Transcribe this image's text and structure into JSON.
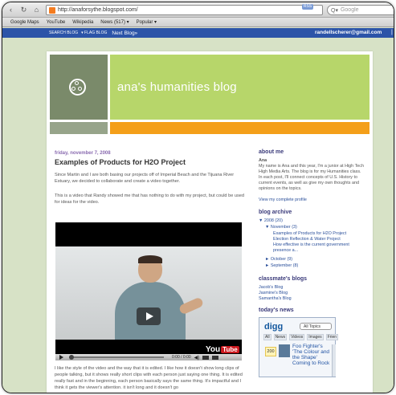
{
  "browser": {
    "url": "http://anaforsythe.blogspot.com/",
    "rss_label": "RSS",
    "search_placeholder": "Google",
    "search_icon": "Q▾",
    "back_icon": "‹",
    "refresh_icon": "↻",
    "home_icon": "⌂",
    "bookmarks": [
      "Google Maps",
      "YouTube",
      "Wikipedia",
      "News (517) ▾",
      "Popular ▾"
    ]
  },
  "navbar": {
    "search_blog": "SEARCH BLOG",
    "flag_blog": "▾ FLAG BLOG",
    "next_blog": "Next Blog»",
    "email": "randellscherer@gmail.com",
    "sep": "|"
  },
  "blog": {
    "title": "ana's humanities blog",
    "colors": {
      "banner": "#b7d66a",
      "orange": "#f49f1a",
      "logo": "#7a8a6a",
      "page_bg": "#d7e2c6"
    }
  },
  "post": {
    "date": "friday, november 7, 2008",
    "title": "Examples of Products for H2O Project",
    "p1": "Since Martin and I are both basing our projects off of Imperial Beach and the Tijuana River Estuary, we decided to collaborate and create a video together.",
    "p2": "This is a video that Randy showed me that has nothing to do with my project, but could be used for ideas for the video.",
    "video": {
      "time": "0:00 / 0:00",
      "logo_you": "You",
      "logo_tube": "Tube",
      "volume_icon": "◀)"
    },
    "p3": "I like the style of the video and the way that it is edited. I like how it doesn't show long clips of people talking, but it shows really short clips with each person just saying one thing. It is edited really fast and in the beginning, each person basically says the same thing. It's impactful and I think it gets the viewer's attention. it isn't long and it doesn't go"
  },
  "sidebar": {
    "about_heading": "about me",
    "about_name": "Ana",
    "about_text": "My name is Ana and this year, I'm a junior at High Tech High Media Arts. The blog is for my Humanities class. In each post, I'll connect concepts of U.S. History to current events, as well as give my own thoughts and opinions on the topics.",
    "about_link": "View my complete profile",
    "archive_heading": "blog archive",
    "archive": {
      "year": "▼ 2008 (20)",
      "month": "▼ November (3)",
      "posts": [
        "Examples of Products for H2O Project",
        "Election Reflection & Water Project",
        "How effective is the current government presence a..."
      ],
      "october": "► October (9)",
      "september": "► September (8)"
    },
    "classmates_heading": "classmate's blogs",
    "classmates": [
      "Jacob's Blog",
      "Jasmine's Blog",
      "Samantha's Blog"
    ],
    "news_heading": "today's news",
    "digg": {
      "logo": "digg",
      "select": "All Topics",
      "tabs": [
        "All",
        "News",
        "Videos",
        "Images",
        "Frien"
      ],
      "count": "200",
      "story": "Foo Fighter's 'The Colour and the Shape' Coming to Rock"
    }
  }
}
